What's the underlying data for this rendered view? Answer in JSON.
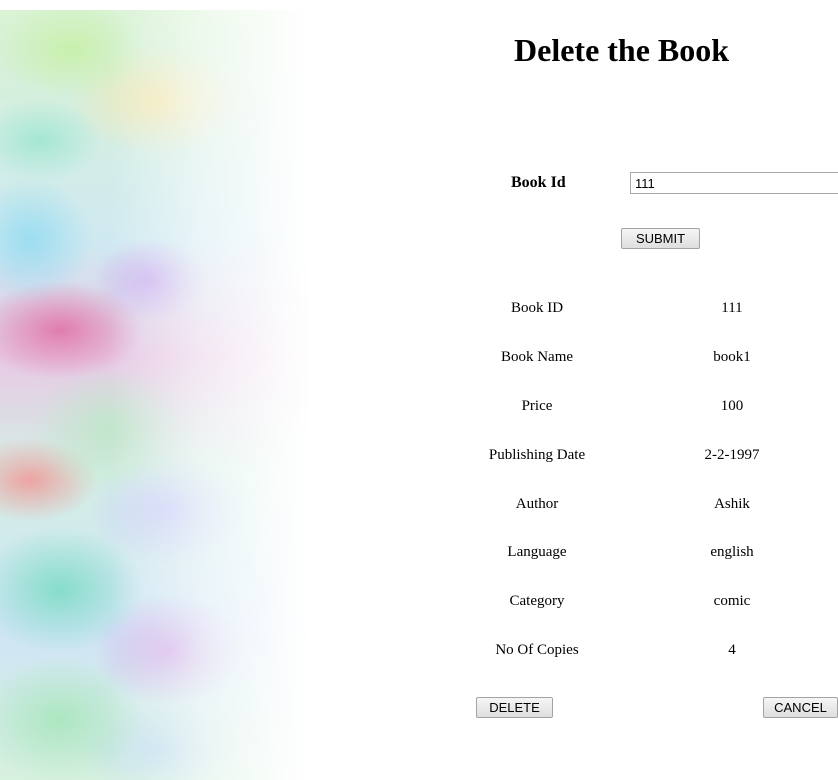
{
  "page": {
    "title": "Delete the Book"
  },
  "search": {
    "label": "Book Id",
    "value": "111",
    "submit_label": "SUBMIT"
  },
  "details": [
    {
      "label": "Book ID",
      "value": "111"
    },
    {
      "label": "Book Name",
      "value": "book1"
    },
    {
      "label": "Price",
      "value": "100"
    },
    {
      "label": "Publishing Date",
      "value": "2-2-1997"
    },
    {
      "label": "Author",
      "value": "Ashik"
    },
    {
      "label": "Language",
      "value": "english"
    },
    {
      "label": "Category",
      "value": "comic"
    },
    {
      "label": "No Of Copies",
      "value": "4"
    }
  ],
  "actions": {
    "delete_label": "DELETE",
    "cancel_label": "CANCEL"
  }
}
